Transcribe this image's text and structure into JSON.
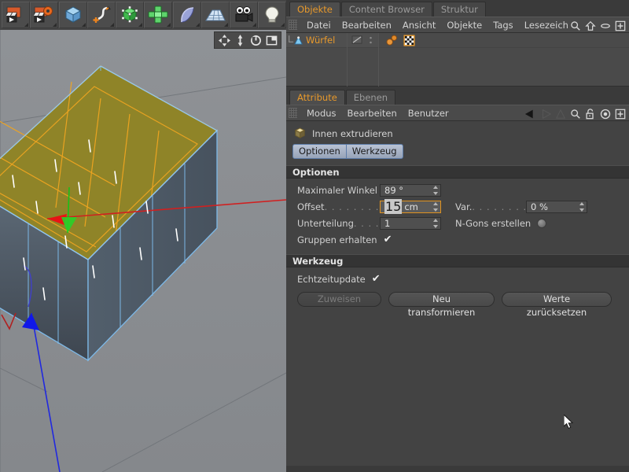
{
  "toolbar": {
    "buttons": [
      {
        "name": "render-view-icon",
        "label": "Render-Ansicht"
      },
      {
        "name": "render-settings-icon",
        "label": "Rendervoreinstellungen"
      },
      {
        "name": "cube-primitive-icon",
        "label": "Würfel"
      },
      {
        "name": "spline-pen-icon",
        "label": "Spline-Werkzeuge"
      },
      {
        "name": "generator-icon",
        "label": "NURBS"
      },
      {
        "name": "array-icon",
        "label": "Array"
      },
      {
        "name": "bend-deformer-icon",
        "label": "Biegen"
      },
      {
        "name": "floor-icon",
        "label": "Boden"
      },
      {
        "name": "camera-icon",
        "label": "Kamera"
      },
      {
        "name": "light-icon",
        "label": "Licht"
      }
    ]
  },
  "viewport": {
    "nav_buttons": [
      {
        "name": "move-camera-icon",
        "label": "Kamera verschieben"
      },
      {
        "name": "zoom-camera-icon",
        "label": "Kamera zoomen"
      },
      {
        "name": "rotate-camera-icon",
        "label": "Kamera drehen"
      },
      {
        "name": "viewport-layout-icon",
        "label": "Ansicht umschalten"
      }
    ]
  },
  "object_manager": {
    "tabs": [
      {
        "label": "Objekte",
        "active": true
      },
      {
        "label": "Content Browser",
        "active": false
      },
      {
        "label": "Struktur",
        "active": false
      }
    ],
    "menu": [
      "Datei",
      "Bearbeiten",
      "Ansicht",
      "Objekte",
      "Tags",
      "Lesezeich"
    ],
    "icons": [
      {
        "name": "search-icon"
      },
      {
        "name": "home-up-icon"
      },
      {
        "name": "ellipse-icon"
      },
      {
        "name": "add-panel-icon"
      }
    ],
    "rows": [
      {
        "name": "Würfel",
        "type": "polygon-object"
      }
    ]
  },
  "attribute_manager": {
    "tabs": [
      {
        "label": "Attribute",
        "active": true
      },
      {
        "label": "Ebenen",
        "active": false
      }
    ],
    "menu": [
      "Modus",
      "Bearbeiten",
      "Benutzer"
    ],
    "icons": [
      {
        "name": "back-arrow-icon"
      },
      {
        "name": "forward-arrow-icon"
      },
      {
        "name": "up-arrow-icon"
      },
      {
        "name": "search-icon"
      },
      {
        "name": "lock-icon"
      },
      {
        "name": "target-icon"
      },
      {
        "name": "add-panel-icon"
      }
    ],
    "tool_title": "Innen extrudieren",
    "mode_tabs": [
      {
        "label": "Optionen",
        "active": true
      },
      {
        "label": "Werkzeug",
        "active": false
      }
    ],
    "sections": {
      "options": {
        "title": "Optionen",
        "max_angle": {
          "label": "Maximaler Winkel",
          "value": "89 °"
        },
        "offset": {
          "label": "Offset",
          "dots": ". . . . . . . . . . .",
          "value_selected": "15",
          "unit": "cm"
        },
        "variance": {
          "label": "Var.",
          "dots": ". . . . . . . . . . .",
          "value": "0 %"
        },
        "subdivision": {
          "label": "Unterteilung",
          "dots": ". . . . .",
          "value": "1"
        },
        "create_ngons": {
          "label": "N-Gons erstellen",
          "checked": false
        },
        "preserve_groups": {
          "label": "Gruppen erhalten",
          "checked": true
        }
      },
      "tool": {
        "title": "Werkzeug",
        "realtime_update": {
          "label": "Echtzeitupdate",
          "checked": true
        },
        "buttons": [
          {
            "label": "Zuweisen",
            "disabled": true
          },
          {
            "label": "Neu transformieren",
            "disabled": false
          },
          {
            "label": "Werte zurücksetzen",
            "disabled": false
          }
        ]
      }
    }
  },
  "colors": {
    "accent_orange": "#e8992b",
    "selected_polygon": "#8f8428",
    "polygon_edge": "#f0a520",
    "object_edge": "#7db9e8",
    "axis_x": "#e02020",
    "axis_y": "#20c020",
    "axis_z": "#2030e0",
    "panel_bg": "#434343",
    "field_bg": "#4f4f4f",
    "focus_border": "#e0921f"
  }
}
